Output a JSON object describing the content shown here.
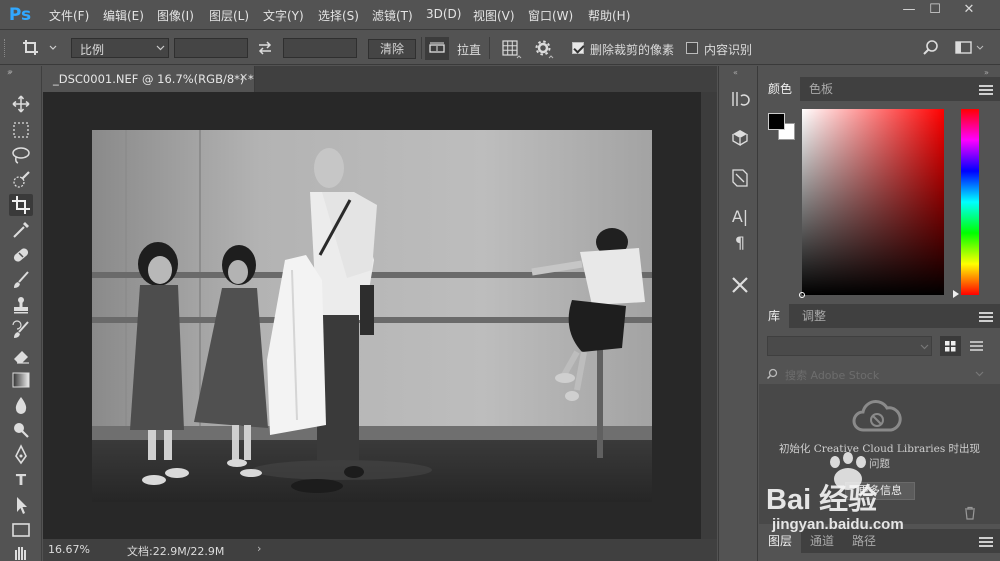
{
  "app": {
    "logo": "Ps"
  },
  "menu": [
    "文件(F)",
    "编辑(E)",
    "图像(I)",
    "图层(L)",
    "文字(Y)",
    "选择(S)",
    "滤镜(T)",
    "3D(D)",
    "视图(V)",
    "窗口(W)",
    "帮助(H)"
  ],
  "window_controls": {
    "minimize": "—",
    "restore": "☐",
    "close": "✕"
  },
  "options": {
    "ratio_select": "比例",
    "clear_button": "清除",
    "straighten_label": "拉直",
    "delete_cropped_label": "删除裁剪的像素",
    "delete_cropped_checked": true,
    "content_aware_label": "内容识别",
    "content_aware_checked": false
  },
  "document": {
    "tab_title": "_DSC0001.NEF @ 16.7%(RGB/8*) *",
    "zoom": "16.67%",
    "doc_size": "文档:22.9M/22.9M"
  },
  "panels": {
    "color_tabs": [
      "颜色",
      "色板"
    ],
    "library_tabs": [
      "库",
      "调整"
    ],
    "library_search_placeholder": "搜索 Adobe Stock",
    "library_message": "初始化 Creative Cloud Libraries 时出现问题",
    "library_button": "更多信息",
    "layers_tabs": [
      "图层",
      "通道",
      "路径"
    ]
  },
  "watermark": {
    "brand": "Bai 经验",
    "url": "jingyan.baidu.com"
  },
  "colors": {
    "ps_blue": "#31a8ff",
    "ui_bg": "#535353",
    "doc_bg": "#282828"
  }
}
